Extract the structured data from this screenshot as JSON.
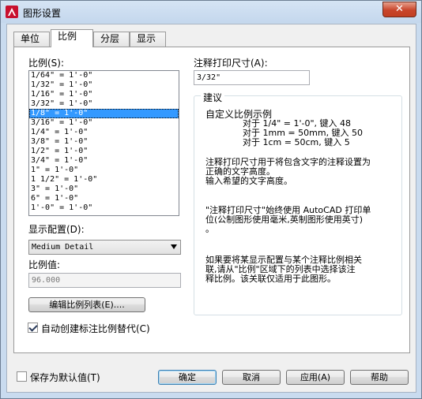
{
  "window": {
    "title": "图形设置",
    "close": "✕"
  },
  "tabs": [
    {
      "label": "单位",
      "active": false
    },
    {
      "label": "比例",
      "active": true
    },
    {
      "label": "分层",
      "active": false
    },
    {
      "label": "显示",
      "active": false
    }
  ],
  "scale": {
    "label": "比例(S):",
    "items": [
      "1/64\" = 1'-0\"",
      "1/32\" = 1'-0\"",
      "1/16\" = 1'-0\"",
      "3/32\" = 1'-0\"",
      "1/8\" = 1'-0\"",
      "3/16\" = 1'-0\"",
      "1/4\" = 1'-0\"",
      "3/8\" = 1'-0\"",
      "1/2\" = 1'-0\"",
      "3/4\" = 1'-0\"",
      "1\" = 1'-0\"",
      "1 1/2\" = 1'-0\"",
      "3\" = 1'-0\"",
      "6\" = 1'-0\"",
      "1'-0\" = 1'-0\""
    ],
    "selected_index": 4
  },
  "display_config": {
    "label": "显示配置(D):",
    "value": "Medium Detail"
  },
  "scale_value": {
    "label": "比例值:",
    "value": "96.000"
  },
  "edit_scale_list_button": "编辑比例列表(E)....",
  "auto_create_checkbox": {
    "label": "自动创建标注比例替代(C)",
    "checked": true
  },
  "annotation_size": {
    "label": "注释打印尺寸(A):",
    "value": "3/32\""
  },
  "suggestion": {
    "title": "建议",
    "heading": "自定义比例示例",
    "examples": [
      "对于 1/4\" = 1'-0\", 键入 48",
      "对于 1mm = 50mm, 键入 50",
      "对于 1cm = 50cm, 键入 5"
    ],
    "para1_line1": "注释打印尺寸用于将包含文字的注释设置为",
    "para1_line2": "正确的文字高度。",
    "para1_line3": "输入希望的文字高度。",
    "para2_line1": "\"注释打印尺寸\"始终使用 AutoCAD 打印单",
    "para2_line2": "位(公制图形使用毫米,英制图形使用英寸)",
    "para2_line3": "。",
    "para3_line1": "如果要将某显示配置与某个注释比例相关",
    "para3_line2": "联,请从\"比例\"区域下的列表中选择该注",
    "para3_line3": "释比例。该关联仅适用于此图形。"
  },
  "save_default_checkbox": {
    "label": "保存为默认值(T)",
    "checked": false
  },
  "buttons": {
    "ok": "确定",
    "cancel": "取消",
    "apply": "应用(A)",
    "help": "帮助"
  }
}
